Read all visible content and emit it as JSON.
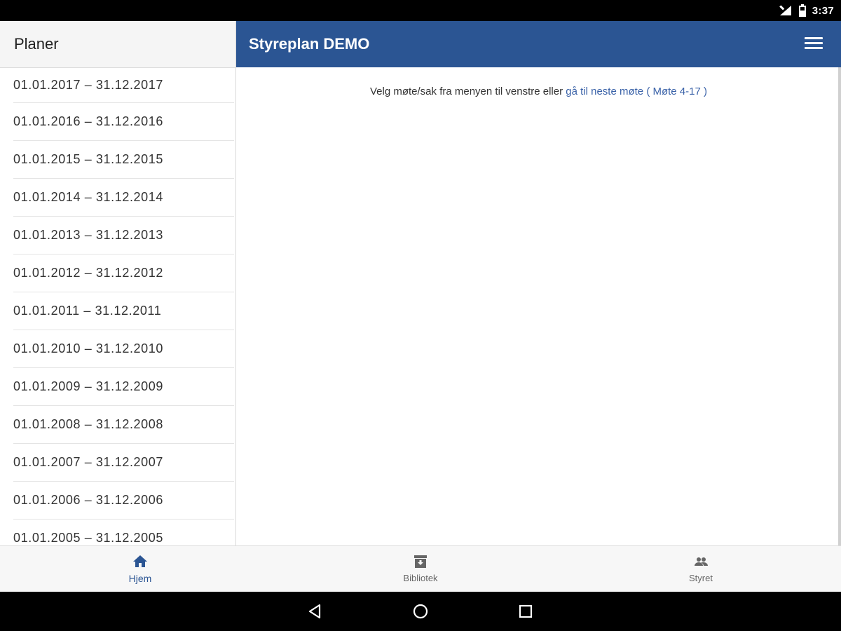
{
  "status_bar": {
    "time": "3:37"
  },
  "sidebar": {
    "title": "Planer",
    "plans": [
      "01.01.2017 – 31.12.2017",
      "01.01.2016 – 31.12.2016",
      "01.01.2015 – 31.12.2015",
      "01.01.2014 – 31.12.2014",
      "01.01.2013 – 31.12.2013",
      "01.01.2012 – 31.12.2012",
      "01.01.2011 – 31.12.2011",
      "01.01.2010 – 31.12.2010",
      "01.01.2009 – 31.12.2009",
      "01.01.2008 – 31.12.2008",
      "01.01.2007 – 31.12.2007",
      "01.01.2006 – 31.12.2006",
      "01.01.2005 – 31.12.2005"
    ]
  },
  "header": {
    "title": "Styreplan DEMO",
    "menu_icon": "hamburger-menu-icon"
  },
  "main": {
    "hint_text": "Velg møte/sak fra menyen til venstre eller ",
    "hint_link": "gå til neste møte ( Møte 4-17 )"
  },
  "bottom_nav": {
    "items": [
      {
        "label": "Hjem",
        "icon": "home-icon",
        "active": true
      },
      {
        "label": "Bibliotek",
        "icon": "archive-icon",
        "active": false
      },
      {
        "label": "Styret",
        "icon": "people-icon",
        "active": false
      }
    ]
  },
  "colors": {
    "brand": "#2b5593",
    "link": "#3a62a8"
  }
}
